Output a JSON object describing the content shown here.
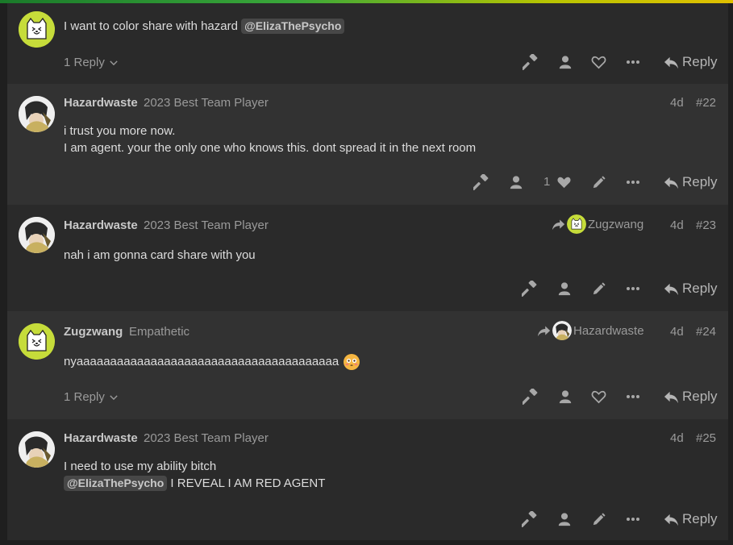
{
  "posts": [
    {
      "body_lines": [
        "I want to color share with hazard"
      ],
      "mention": "@ElizaThePsycho",
      "replies_label": "1 Reply",
      "reply_label": "Reply"
    },
    {
      "username": "Hazardwaste",
      "user_title": "2023 Best Team Player",
      "date": "4d",
      "number": "#22",
      "body_lines": [
        "i trust you more now.",
        "I am agent. your the only one who knows this. dont spread it in the next room"
      ],
      "like_count": "1",
      "reply_label": "Reply"
    },
    {
      "username": "Hazardwaste",
      "user_title": "2023 Best Team Player",
      "reply_to": "Zugzwang",
      "date": "4d",
      "number": "#23",
      "body_lines": [
        "nah i am gonna card share with you"
      ],
      "reply_label": "Reply"
    },
    {
      "username": "Zugzwang",
      "user_title": "Empathetic",
      "reply_to": "Hazardwaste",
      "date": "4d",
      "number": "#24",
      "body_lines": [
        "nyaaaaaaaaaaaaaaaaaaaaaaaaaaaaaaaaaaaaaaa"
      ],
      "emoji": "flushed-face",
      "replies_label": "1 Reply",
      "reply_label": "Reply"
    },
    {
      "username": "Hazardwaste",
      "user_title": "2023 Best Team Player",
      "date": "4d",
      "number": "#25",
      "body_lines": [
        "I need to use my ability bitch",
        "I REVEAL I AM RED AGENT"
      ],
      "mention": "@ElizaThePsycho",
      "reply_label": "Reply"
    }
  ],
  "icons": [
    "hammer-icon",
    "user-icon",
    "heart-icon",
    "pencil-icon",
    "more-icon",
    "reply-arrow-icon",
    "share-arrow-icon",
    "chevron-down-icon"
  ],
  "colors": {
    "cat_avatar": "#c6dc3a",
    "post_bg_dark": "#2a2a2a",
    "post_bg_light": "#323232",
    "mention_bg": "#474747"
  }
}
